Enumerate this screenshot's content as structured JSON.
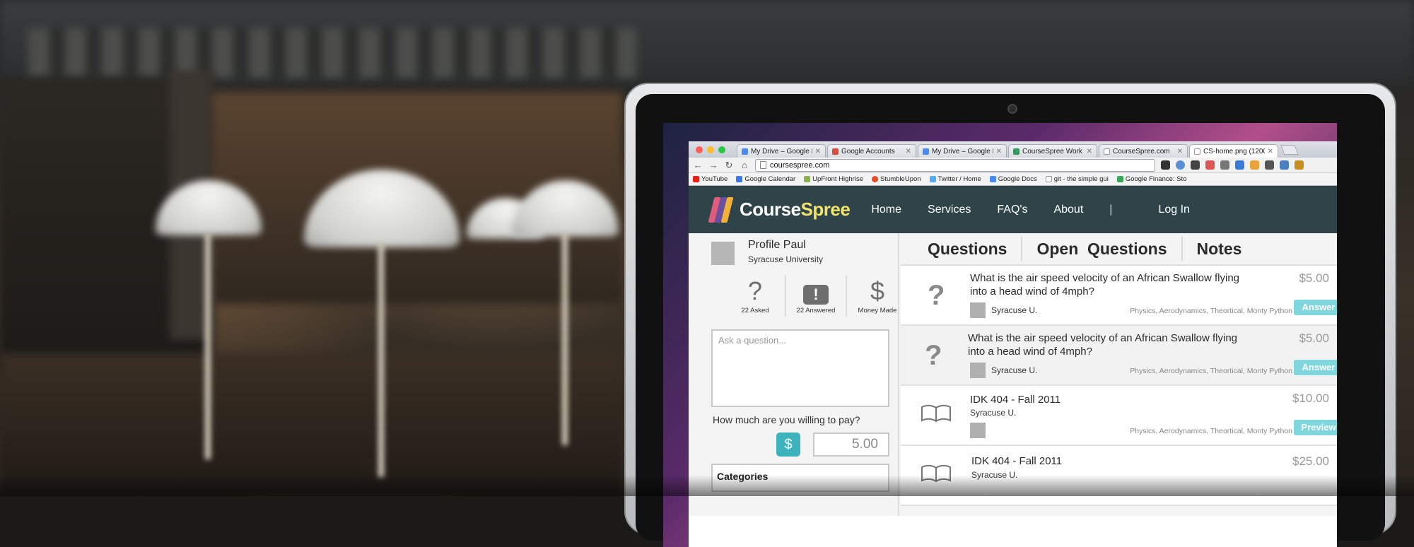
{
  "browser": {
    "tabs": [
      {
        "label": "My Drive – Google D",
        "color": "#4a8af4"
      },
      {
        "label": "Google Accounts",
        "color": "#dd4b39"
      },
      {
        "label": "My Drive – Google D",
        "color": "#4a8af4"
      },
      {
        "label": "CourseSpree Work L",
        "color": "#2e9e5b"
      },
      {
        "label": "CourseSpree.com",
        "color": "#888888"
      },
      {
        "label": "CS-home.png (1200",
        "color": "#888888"
      }
    ],
    "url": "coursespree.com",
    "bookmarks": [
      {
        "label": "YouTube",
        "color": "#e62117"
      },
      {
        "label": "Google Calendar",
        "color": "#3b78e7"
      },
      {
        "label": "UpFront Highrise",
        "color": "#8bb14a"
      },
      {
        "label": "StumbleUpon",
        "color": "#eb4924"
      },
      {
        "label": "Twitter / Home",
        "color": "#55acee"
      },
      {
        "label": "Google Docs",
        "color": "#4a8af4"
      },
      {
        "label": "git - the simple gui",
        "color": "#999999"
      },
      {
        "label": "Google Finance: Sto",
        "color": "#3aa757"
      }
    ],
    "more_glyph": "»"
  },
  "site": {
    "logo_main": "Course",
    "logo_accent": "Spree",
    "nav": [
      "Home",
      "Services",
      "FAQ's",
      "About"
    ],
    "nav_divider": "|",
    "login": "Log In"
  },
  "profile": {
    "name": "Profile Paul",
    "school": "Syracuse University",
    "stats": [
      {
        "symbol": "?",
        "caption": "22 Asked"
      },
      {
        "symbol": "!",
        "caption": "22 Answered"
      },
      {
        "symbol": "$",
        "caption": "Money Made"
      }
    ],
    "ask_placeholder": "Ask a question...",
    "pay_question": "How much are you willing to pay?",
    "dollar": "$",
    "amount": "5.00",
    "categories": "Categories"
  },
  "panel_tabs": [
    "Questions",
    "Open  Questions",
    "Notes"
  ],
  "items": [
    {
      "kind": "question",
      "title": "What is the air speed velocity of an African Swallow flying into a head wind of 4mph?",
      "school": "Syracuse U.",
      "tags": "Physics, Aerodynamics, Theortical, Monty Python",
      "price": "$5.00",
      "action": "Answer"
    },
    {
      "kind": "question",
      "title": "What is the air speed velocity of an African Swallow flying into a head wind of 4mph?",
      "school": "Syracuse U.",
      "tags": "Physics, Aerodynamics, Theortical, Monty Python",
      "price": "$5.00",
      "action": "Answer"
    },
    {
      "kind": "note",
      "title": "IDK 404 - Fall 2011",
      "school": "Syracuse U.",
      "tags": "Physics, Aerodynamics, Theortical, Monty Python",
      "price": "$10.00",
      "action": "Preview"
    },
    {
      "kind": "note",
      "title": "IDK 404 - Fall 2011",
      "school": "Syracuse U.",
      "tags": "",
      "price": "$25.00",
      "action": ""
    }
  ],
  "colors": {
    "nav_bg": "#2f4449",
    "accent": "#3db3bd",
    "button": "#7fd6dc",
    "logo_accent": "#f2e36b"
  }
}
